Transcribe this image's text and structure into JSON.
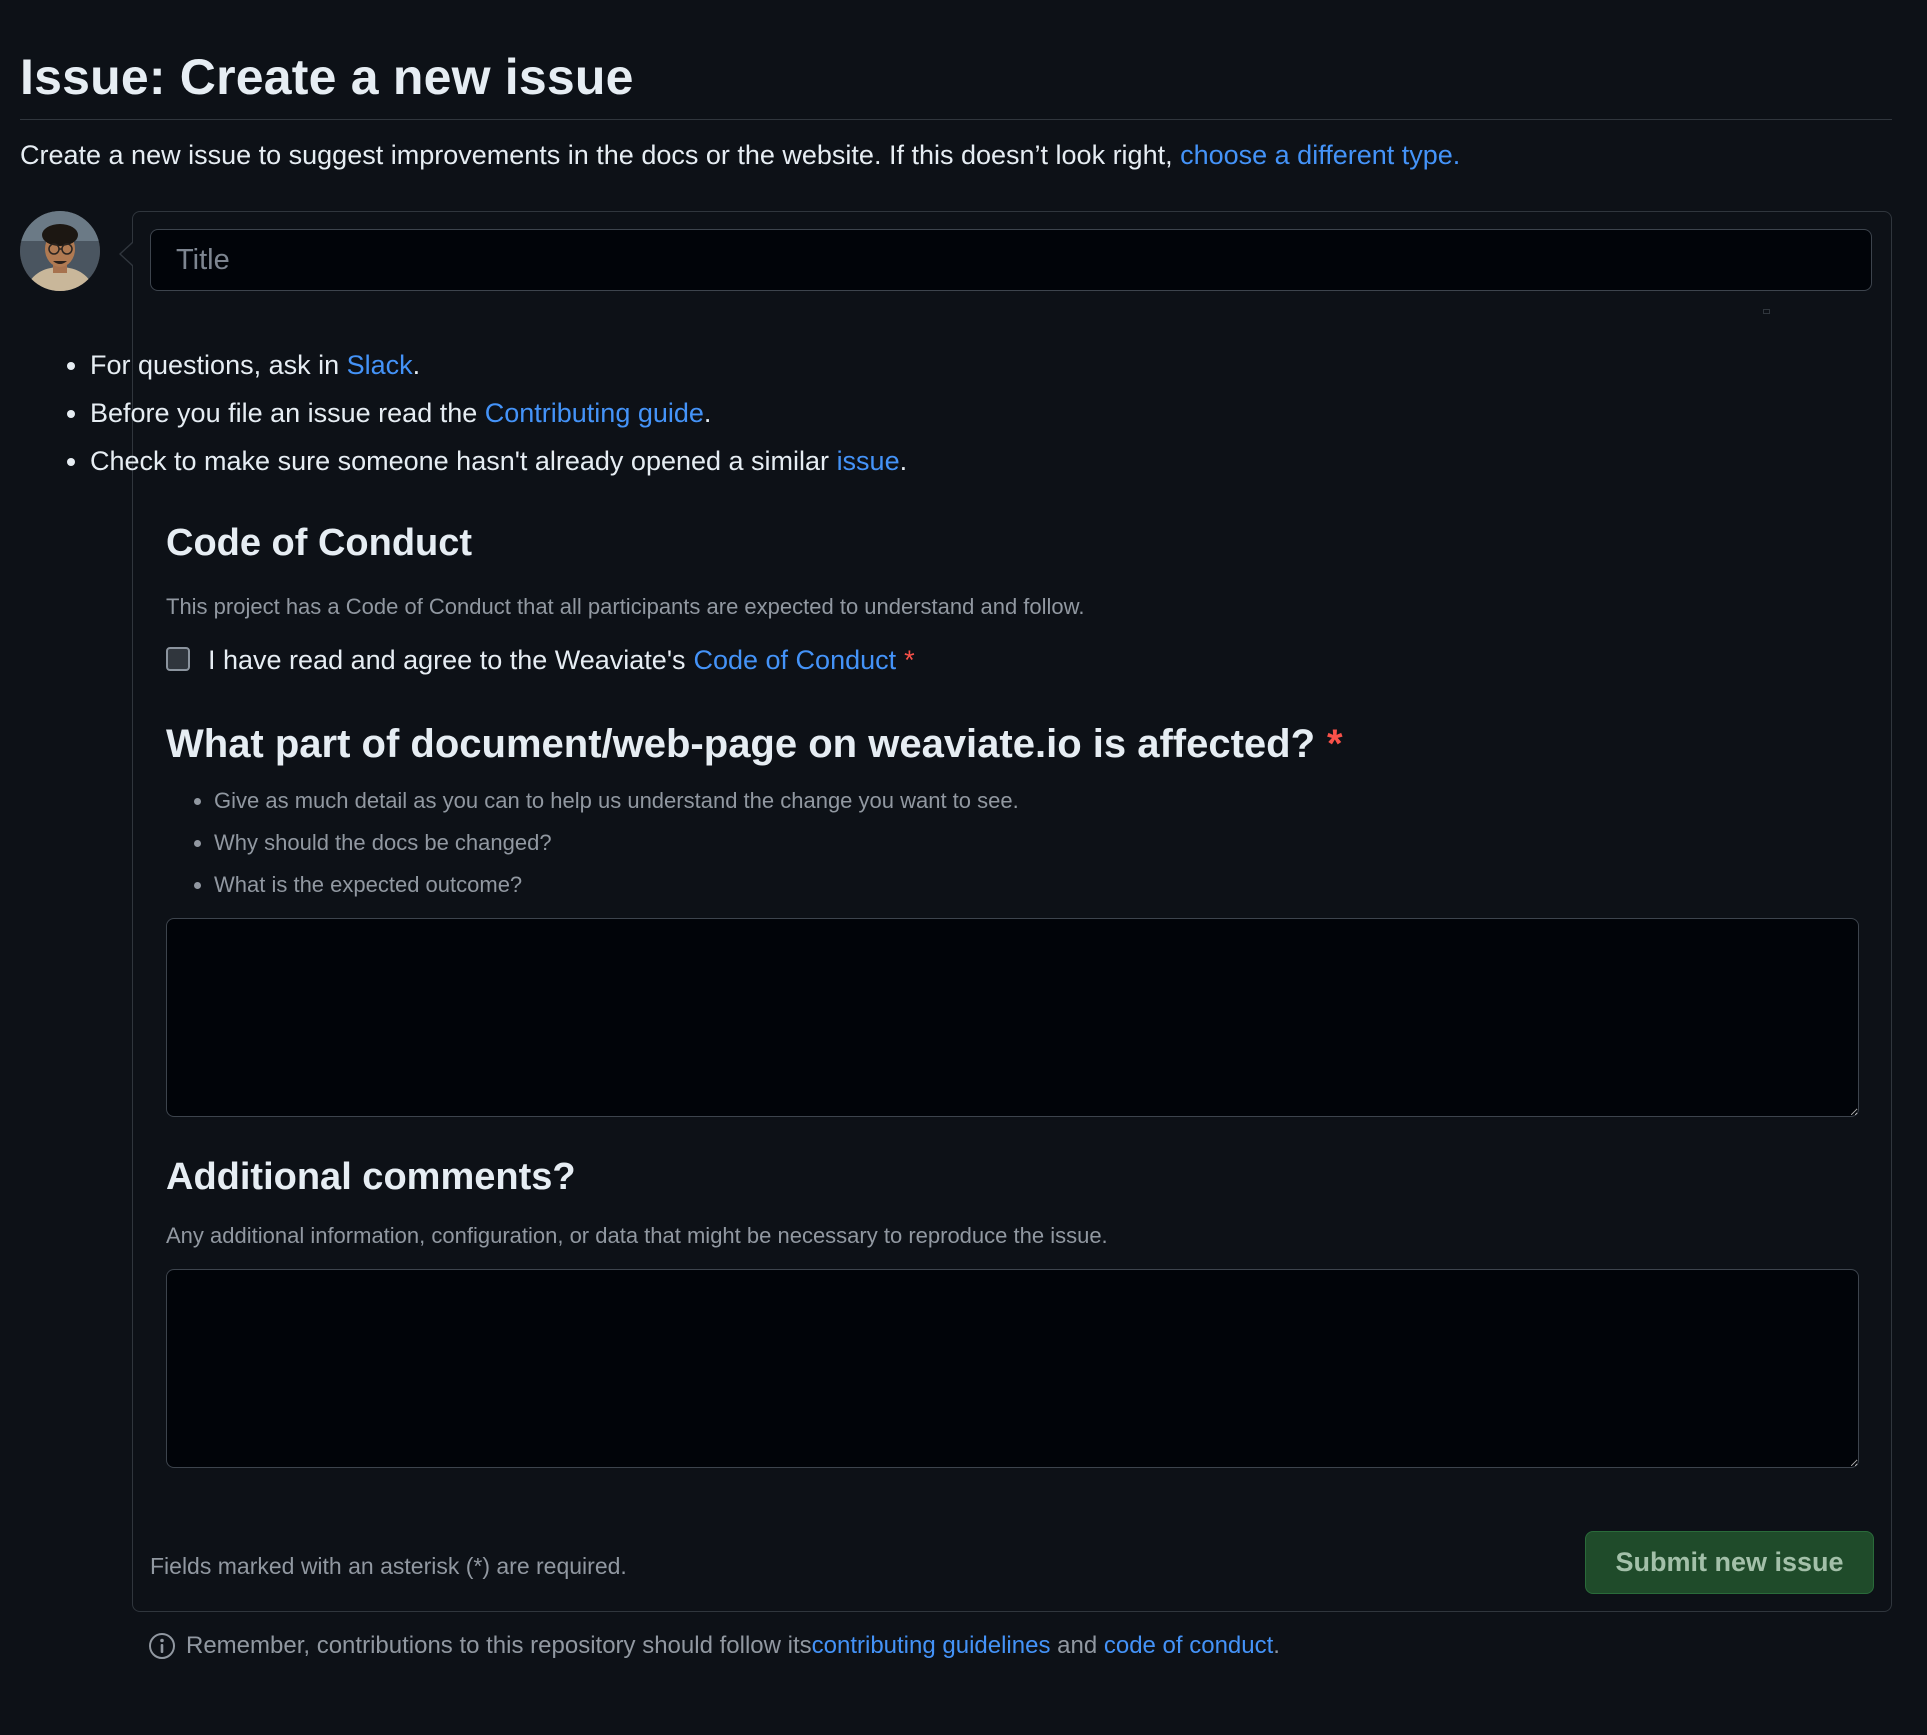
{
  "page": {
    "title": "Issue: Create a new issue",
    "subtitle_text": "Create a new issue to suggest improvements in the docs or the website. If this doesn’t look right, ",
    "subtitle_link": "choose a different type."
  },
  "form": {
    "title_placeholder": "Title",
    "intro": [
      {
        "before": "For questions, ask in ",
        "link": "Slack",
        "after": "."
      },
      {
        "before": "Before you file an issue read the ",
        "link": "Contributing guide",
        "after": "."
      },
      {
        "before": "Check to make sure someone hasn't already opened a similar ",
        "link": "issue",
        "after": "."
      }
    ],
    "code_of_conduct": {
      "heading": "Code of Conduct",
      "description": "This project has a Code of Conduct that all participants are expected to understand and follow.",
      "checkbox_text": "I have read and agree to the Weaviate's ",
      "checkbox_link": "Code of Conduct",
      "required_mark": "*",
      "checked": false
    },
    "affected": {
      "heading": "What part of document/web-page on weaviate.io is affected?",
      "required_mark": "*",
      "hints": [
        "Give as much detail as you can to help us understand the change you want to see.",
        "Why should the docs be changed?",
        "What is the expected outcome?"
      ],
      "value": ""
    },
    "additional": {
      "heading": "Additional comments?",
      "description": "Any additional information, configuration, or data that might be necessary to reproduce the issue.",
      "value": ""
    },
    "required_note": "Fields marked with an asterisk (*) are required.",
    "submit_label": "Submit new issue"
  },
  "footer": {
    "text_before": "Remember, contributions to this repository should follow its ",
    "link1": "contributing guidelines",
    "text_middle": " and ",
    "link2": "code of conduct",
    "text_after": "."
  },
  "colors": {
    "background": "#0d1117",
    "link": "#4493f8",
    "required": "#f85149",
    "submit_bg": "#1f4b2a",
    "border": "#30363d"
  },
  "icons": {
    "avatar": "user-avatar",
    "info": "info-icon"
  }
}
